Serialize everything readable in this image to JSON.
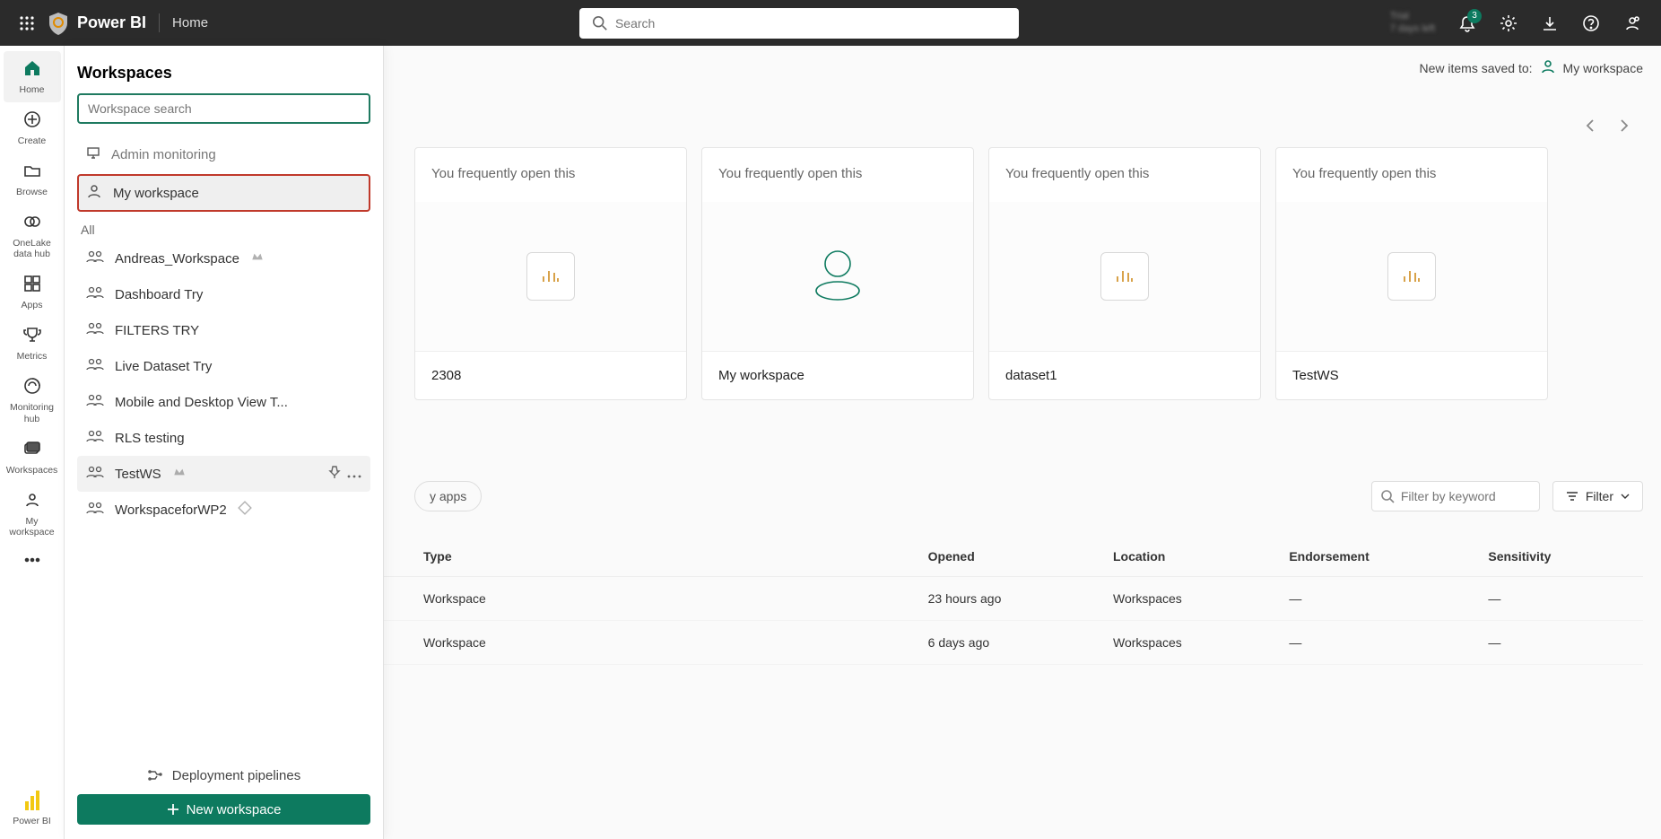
{
  "topbar": {
    "brand": "Power BI",
    "crumb": "Home",
    "search_placeholder": "Search",
    "trial_line1": "Trial",
    "trial_line2": "7 days left",
    "notification_count": "3"
  },
  "rail": {
    "items": [
      {
        "label": "Home"
      },
      {
        "label": "Create"
      },
      {
        "label": "Browse"
      },
      {
        "label": "OneLake\ndata hub"
      },
      {
        "label": "Apps"
      },
      {
        "label": "Metrics"
      },
      {
        "label": "Monitoring\nhub"
      },
      {
        "label": "Workspaces"
      },
      {
        "label": "My\nworkspace"
      }
    ],
    "bottom_label": "Power BI"
  },
  "flyout": {
    "title": "Workspaces",
    "search_placeholder": "Workspace search",
    "admin_monitoring": "Admin monitoring",
    "my_workspace": "My workspace",
    "section_all": "All",
    "items": [
      {
        "label": "Andreas_Workspace",
        "premium": true
      },
      {
        "label": "Dashboard Try"
      },
      {
        "label": "FILTERS TRY"
      },
      {
        "label": "Live Dataset Try"
      },
      {
        "label": "Mobile and Desktop View T..."
      },
      {
        "label": "RLS testing"
      },
      {
        "label": "TestWS",
        "premium": true,
        "hovered": true
      },
      {
        "label": "WorkspaceforWP2",
        "diamond": true
      }
    ],
    "deployment_pipelines": "Deployment pipelines",
    "new_workspace": "New workspace"
  },
  "main": {
    "saved_to_label": "New items saved to:",
    "saved_to_target": "My workspace",
    "freq_label": "You frequently open this",
    "cards": [
      {
        "title": "2308",
        "art": "report"
      },
      {
        "title": "My workspace",
        "art": "person"
      },
      {
        "title": "dataset1",
        "art": "report"
      },
      {
        "title": "TestWS",
        "art": "report"
      }
    ],
    "chip_my_apps": "y apps",
    "filter_placeholder": "Filter by keyword",
    "filter_button": "Filter",
    "table": {
      "columns": [
        "Type",
        "Opened",
        "Location",
        "Endorsement",
        "Sensitivity"
      ],
      "rows": [
        {
          "type": "Workspace",
          "opened": "23 hours ago",
          "location": "Workspaces",
          "endorsement": "—",
          "sensitivity": "—"
        },
        {
          "type": "Workspace",
          "opened": "6 days ago",
          "location": "Workspaces",
          "endorsement": "—",
          "sensitivity": "—"
        }
      ]
    }
  }
}
